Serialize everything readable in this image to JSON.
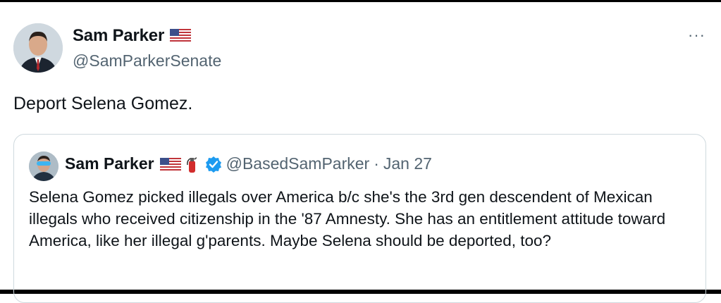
{
  "tweet": {
    "author": {
      "name": "Sam Parker",
      "handle": "@SamParkerSenate",
      "avatar": "avatar-man-suit",
      "badge": "us-flag-icon"
    },
    "text": "Deport Selena Gomez.",
    "more_icon": "more-icon",
    "more_label": "···"
  },
  "quote": {
    "author": {
      "name": "Sam Parker",
      "handle": "@BasedSamParker",
      "separator": "·",
      "date": "Jan 27",
      "badges": [
        "us-flag-icon",
        "fire-extinguisher-icon",
        "verified-badge-icon"
      ]
    },
    "text": "Selena Gomez picked illegals over America b/c she's the 3rd gen descendent of Mexican illegals who received citizenship in the '87 Amnesty. She has an entitlement attitude toward America, like her illegal g'parents. Maybe Selena should be deported, too?"
  },
  "colors": {
    "text": "#0f1419",
    "secondary": "#536471",
    "verified": "#1d9bf0",
    "border": "#cfd9de"
  }
}
